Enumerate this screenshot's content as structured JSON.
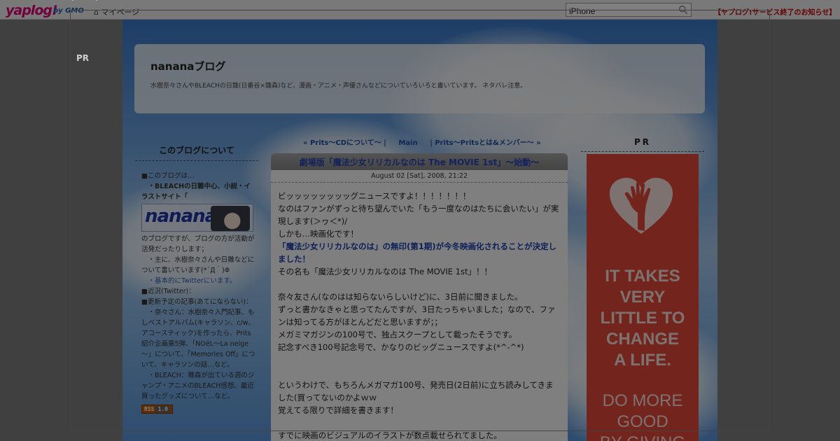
{
  "topbar": {
    "logo": "yaplog!",
    "logo_by": "by GMO",
    "mypage": "マイページ",
    "search_value": "iPhone",
    "notice": "【ヤプログ!サービス終了のお知らせ】"
  },
  "blog": {
    "title": "nananaブログ",
    "description": "水樹奈々さんやBLEACHの日雛(日番谷×雛森)など、漫画・アニメ・声優さんなどについていろいろと書いています。 ネタバレ注意。"
  },
  "postnav": {
    "prev": "« Prits～CDについて～ |",
    "main": "Main",
    "next": "| Prits～Pritsとは&メンバー～ »"
  },
  "left": {
    "heading": "このブログについて",
    "lines": [
      "■このブログは…",
      "　・BLEACHの日雛中心、小説・イラストサイト「",
      "のブログですが、ブログの方が活動が活発だったりします；",
      "　・主に、水樹奈々さんや日雛などについて書いています(*´Д｀)Φ",
      "　・基本的にTwitterにいます。",
      "■近況(Twitter)：",
      "■更新予定の記事(あてにならない)：",
      "　・奈々さん：水樹奈々入門記事、もしベストアルバム(キャラソン、c/w、アコースティック)を作ったら、Prits紹介企画第5弾、「NOëL～La neige～」について、「Memories Off」について、キャラソンの話…など。",
      "　・BLEACH：雛森が出ている週のジャンプ・アニメのBLEACH感想、最近買ったグッズについて…など。"
    ],
    "banner_text": "nanana",
    "rss_badge": "RSS",
    "rss_version": "1.0"
  },
  "post": {
    "title": "劇場版「魔法少女リリカルなのは The MOVIE 1st」～始動～",
    "date": "August 02 [Sat], 2008, 21:22",
    "lines": [
      "ビッッッッッッッッグニュースですよ！！！！！！！",
      "なのはファンがずっと待ち望んでいた「もう一度なのはたちに会いたい」が実現します(＞ヮ＜*)/",
      "しかも…映画化です！",
      "「魔法少女リリカルなのは」の無印(第1期)が今冬映画化されることが決定しました！",
      "その名も「魔法少女リリカルなのは The MOVIE 1st」！！",
      "奈々友さん(なのはは知らないらしいけど)に、3日前に聞きました。",
      "ずっと書かなきゃと思ってたんですが、3日たっちゃいました；なので、ファンは知ってる方がほとんどだと思いますが；；",
      "メガミマガジンの100号で、独占スクープとして載ったそうです。",
      "記念すべき100号記念号で、かなりのビッグニュースですよ(*^-^*)",
      "というわけで、もちろんメガマガ100号、発売日(2日前)に立ち読みしてきました(買ってないのかよｗｗ",
      "覚えてる限りで詳細を書きます！",
      "すでに映画のビジュアルのイラストが数点載せられてました。"
    ]
  },
  "right": {
    "pr_heading": "PR",
    "ad_lines": [
      "IT TAKES",
      "VERY",
      "LITTLE TO",
      "CHANGE",
      "A LIFE."
    ],
    "ad_lines2": [
      "DO MORE",
      "GOOD",
      "BY GIVING"
    ]
  },
  "overlay": {
    "pr_label": "PR"
  },
  "icons": {
    "search": "search-icon",
    "home": "home-icon",
    "close": "close-icon",
    "heart_hand": "heart-hand-icon"
  },
  "colors": {
    "ad_bg": "#e64a3b",
    "notice": "#cc0000",
    "link": "#2a58b8"
  }
}
